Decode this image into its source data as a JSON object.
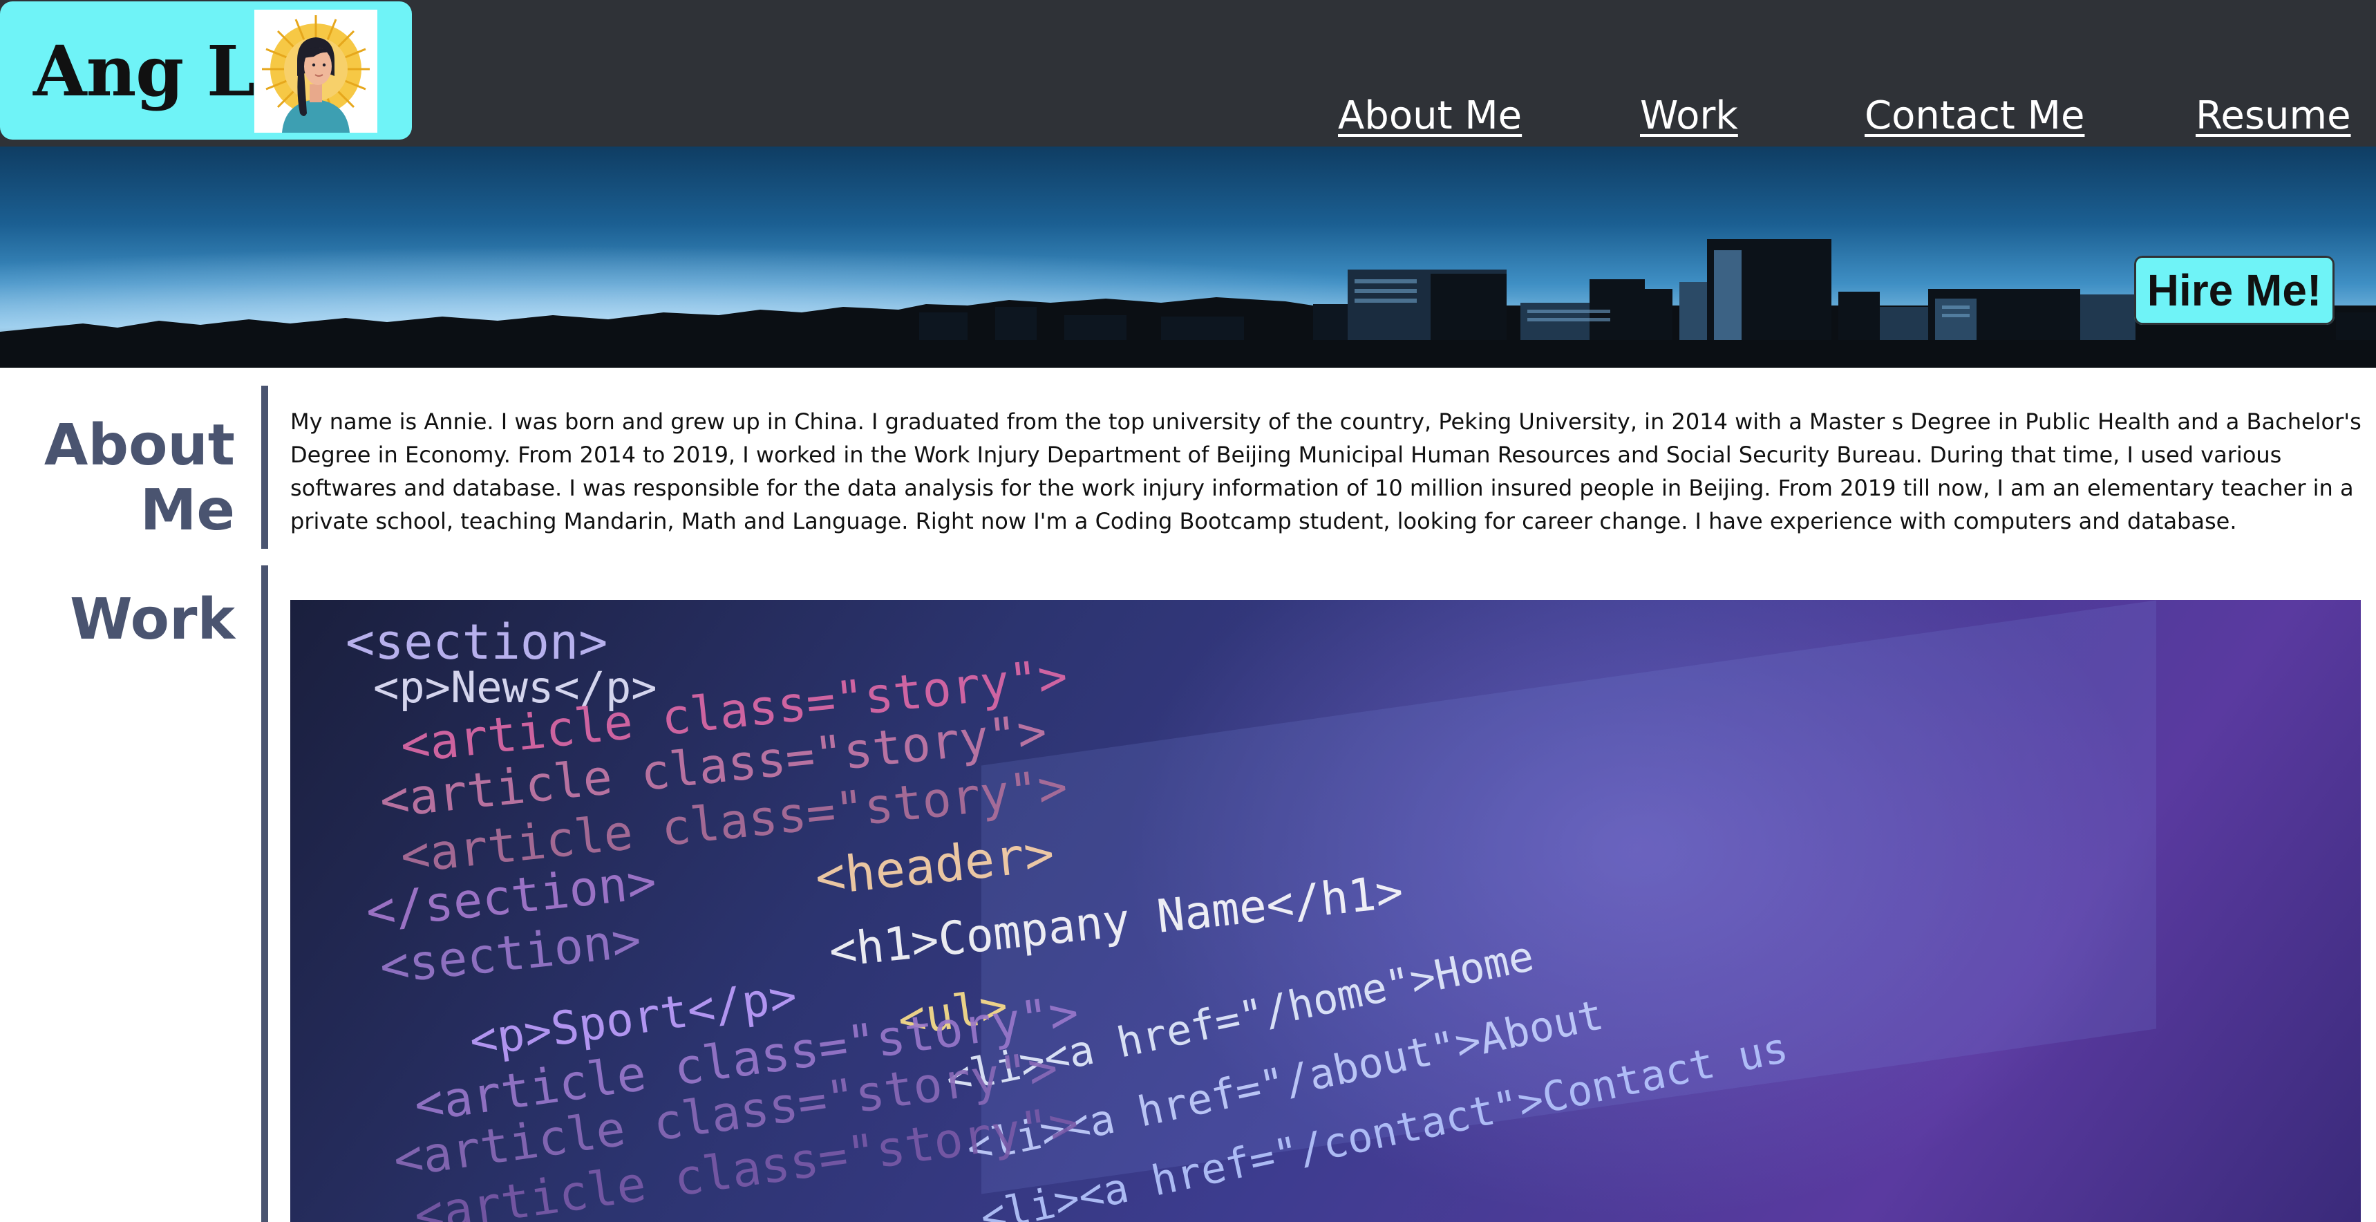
{
  "brand": {
    "name": "Ang Li"
  },
  "nav": [
    "About Me",
    "Work",
    "Contact Me",
    "Resume"
  ],
  "hero": {
    "cta": "Hire Me!"
  },
  "about": {
    "title_line1": "About",
    "title_line2": "Me",
    "text": "My name is Annie. I was born and grew up in China. I graduated from the top university of the country, Peking University, in 2014 with a Master s Degree in Public Health and a Bachelor's Degree in Economy. From 2014 to 2019, I worked in the Work Injury Department of Beijing Municipal Human Resources and Social Security Bureau. During that time, I used various softwares and database. I was responsible for the data analysis for the work injury information of 10 million insured people in Beijing. From 2019 till now, I am an elementary teacher in a private school, teaching Mandarin, Math and Language. Right now I'm a Coding Bootcamp student, looking for career change. I have experience with computers and database."
  },
  "work": {
    "title": "Work",
    "image_code": [
      "<section>",
      "<p>News</p>",
      "<article class=\"story\">",
      "<article class=\"story\">",
      "<article class=\"story\">",
      "<header>",
      "<h1>Company Name</h1>",
      "</section>",
      "<section>",
      "<ul>",
      "<p>Sport</p>",
      "<li><a href=\"/home\">Home",
      "<article class=\"story\">",
      "<li><a href=\"/about\">About",
      "<article class=\"story\">",
      "<li><a href=\"/contact\">Contact us",
      "<article class=\"story\">"
    ]
  },
  "colors": {
    "topbar": "#2f3237",
    "accent_cyan": "#6ff3f7",
    "section_title": "#4a5470"
  },
  "icons": [
    "avatar-illustration",
    "city-skyline",
    "code-screen-photo"
  ]
}
